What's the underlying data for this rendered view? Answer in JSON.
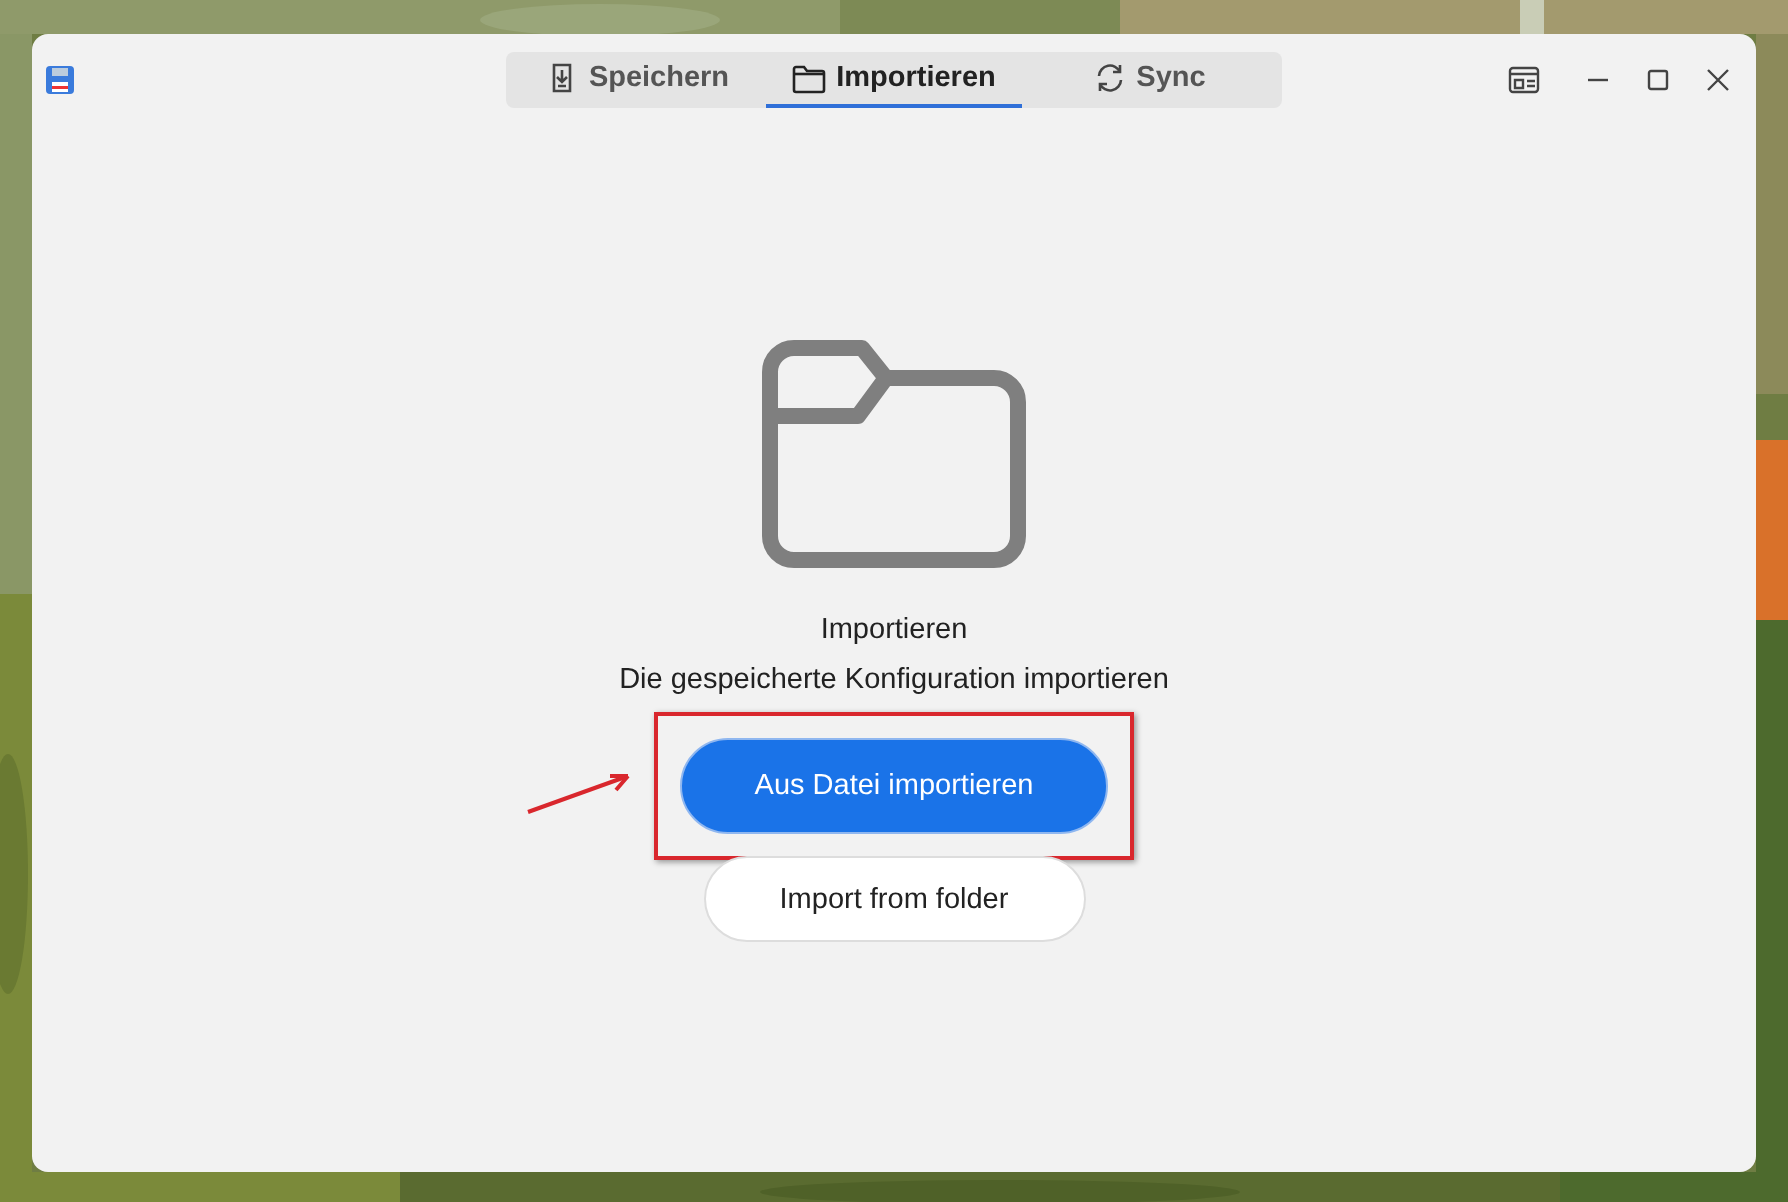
{
  "tabs": [
    {
      "label": "Speichern",
      "selected": false
    },
    {
      "label": "Importieren",
      "selected": true
    },
    {
      "label": "Sync",
      "selected": false
    }
  ],
  "content": {
    "title": "Importieren",
    "description": "Die gespeicherte Konfiguration importieren"
  },
  "buttons": [
    {
      "label": "Aus Datei importieren",
      "kind": "primary",
      "highlighted": true
    },
    {
      "label": "Import from folder",
      "kind": "secondary",
      "highlighted": false
    }
  ]
}
